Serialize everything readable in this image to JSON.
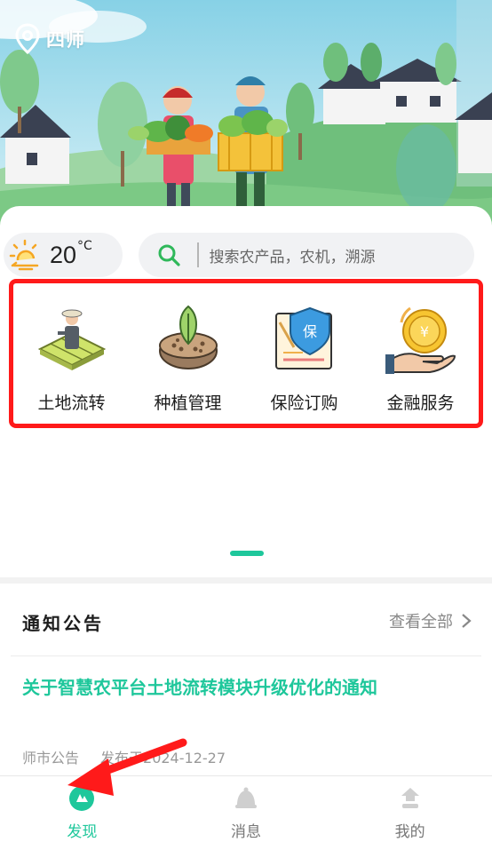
{
  "header": {
    "location": "四师"
  },
  "weather": {
    "temp": "20",
    "unit": "°C"
  },
  "search": {
    "placeholder": "搜索农产品，农机，溯源"
  },
  "services": [
    {
      "label": "土地流转",
      "icon": "land-transfer-icon"
    },
    {
      "label": "种植管理",
      "icon": "planting-icon"
    },
    {
      "label": "保险订购",
      "icon": "insurance-icon"
    },
    {
      "label": "金融服务",
      "icon": "finance-icon"
    }
  ],
  "notice": {
    "heading": "通知公告",
    "view_all": "查看全部",
    "title": "关于智慧农平台土地流转模块升级优化的通知",
    "source": "师市公告",
    "date_label": "发布于2024-12-27"
  },
  "tabbar": {
    "items": [
      {
        "label": "发现",
        "active": true
      },
      {
        "label": "消息",
        "active": false
      },
      {
        "label": "我的",
        "active": false
      }
    ]
  },
  "colors": {
    "accent": "#1ec79b",
    "highlight": "#ff1a1a"
  }
}
